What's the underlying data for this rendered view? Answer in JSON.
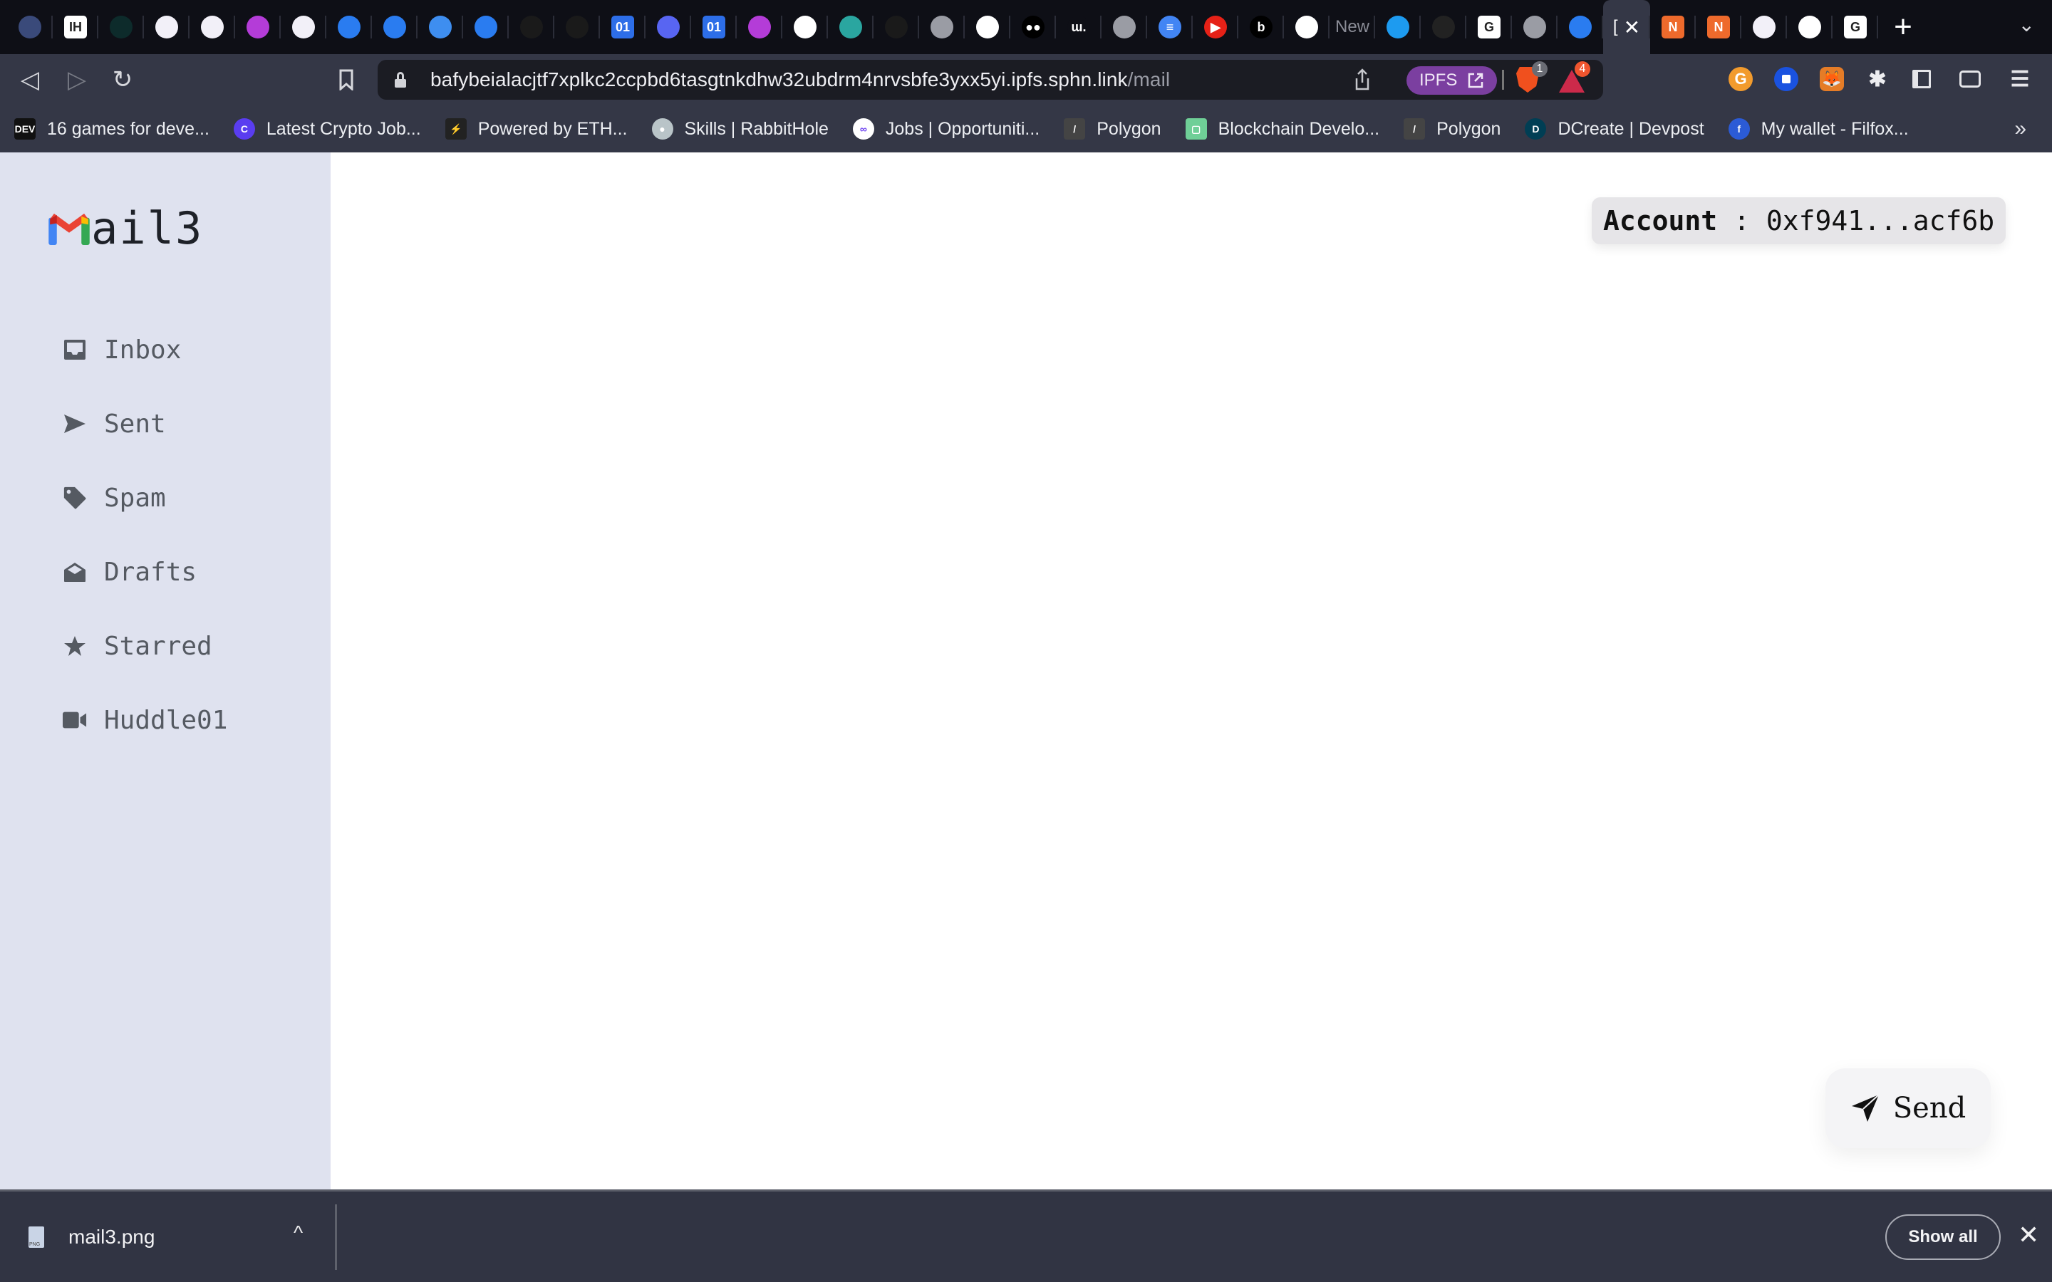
{
  "browser": {
    "tabs": [
      {
        "icon": "ring-icon",
        "color": "#3a4a7a"
      },
      {
        "icon": "indiehackers-icon",
        "color": "#ffffff",
        "glyph": "IH"
      },
      {
        "icon": "owl-icon",
        "color": "#0d2b2b"
      },
      {
        "icon": "ethereum-icon",
        "color": "#f2f0f8"
      },
      {
        "icon": "ethereum-icon",
        "color": "#f2f0f8"
      },
      {
        "icon": "bell-icon",
        "color": "#b43cd8"
      },
      {
        "icon": "ethereum-icon",
        "color": "#f2f0f8"
      },
      {
        "icon": "bolt-icon",
        "color": "#2a7cf0"
      },
      {
        "icon": "bolt-icon",
        "color": "#2a7cf0"
      },
      {
        "icon": "mail-icon",
        "color": "#3e8ef0"
      },
      {
        "icon": "bolt-icon",
        "color": "#2a7cf0"
      },
      {
        "icon": "tower-icon",
        "color": "#1a1a1a"
      },
      {
        "icon": "tower-icon",
        "color": "#1a1a1a"
      },
      {
        "icon": "huddle-icon",
        "color": "#2d6ee8",
        "glyph": "01"
      },
      {
        "icon": "discord-icon",
        "color": "#5865f2"
      },
      {
        "icon": "huddle-icon",
        "color": "#2d6ee8",
        "glyph": "01"
      },
      {
        "icon": "bell-icon",
        "color": "#b43cd8"
      },
      {
        "icon": "github-icon",
        "color": "#ffffff"
      },
      {
        "icon": "figure-icon",
        "color": "#2aa6a0"
      },
      {
        "icon": "tower-icon",
        "color": "#1a1a1a"
      },
      {
        "icon": "globe-icon",
        "color": "#9a9ca4"
      },
      {
        "icon": "github-icon",
        "color": "#ffffff"
      },
      {
        "icon": "medium-icon",
        "color": "#000000",
        "glyph": "●●"
      },
      {
        "icon": "w-icon",
        "color": "#0e0f16",
        "glyph": "ɯ."
      },
      {
        "icon": "globe-icon",
        "color": "#9a9ca4"
      },
      {
        "icon": "docs-icon",
        "color": "#4285f4",
        "glyph": "≡"
      },
      {
        "icon": "youtube-music-icon",
        "color": "#e62117",
        "glyph": "▶"
      },
      {
        "icon": "b-icon",
        "color": "#000000",
        "glyph": "b"
      },
      {
        "icon": "github-icon",
        "color": "#ffffff"
      },
      {
        "icon": "text-tab",
        "color": "",
        "text": "New"
      },
      {
        "icon": "twitter-icon",
        "color": "#1d9bf0"
      },
      {
        "icon": "graduation-cap-icon",
        "color": "#222222"
      },
      {
        "icon": "google-icon",
        "color": "#ffffff",
        "glyph": "G"
      },
      {
        "icon": "globe-icon",
        "color": "#9a9ca4"
      },
      {
        "icon": "bolt-icon",
        "color": "#2a7cf0"
      }
    ],
    "active_tab": {
      "glyph": "[",
      "close": "✕"
    },
    "tabs_after": [
      {
        "icon": "n-icon",
        "color": "#ee6a2c",
        "glyph": "N"
      },
      {
        "icon": "n-icon",
        "color": "#ee6a2c",
        "glyph": "N"
      },
      {
        "icon": "ethereum-icon",
        "color": "#f2f0f8"
      },
      {
        "icon": "github-icon",
        "color": "#ffffff"
      },
      {
        "icon": "google-icon",
        "color": "#ffffff",
        "glyph": "G"
      }
    ],
    "new_tab": "+",
    "tab_menu": "⌄",
    "nav": {
      "back": "◁",
      "forward": "▷",
      "reload": "↻",
      "bookmark": "🔖"
    },
    "url": {
      "host": "bafybeialacjtf7xplkc2ccpbd6tasgtnkdhw32ubdrm4nrvsbfe3yxx5yi.ipfs.sphn.link",
      "path": "/mail"
    },
    "ipfs_label": "IPFS",
    "shields_count": "1",
    "rewards_count": "4",
    "extensions": [
      "gitcoin-icon",
      "coinbase-icon",
      "metamask-icon",
      "puzzle-icon",
      "sidebar-icon",
      "wallet-icon",
      "menu-icon"
    ],
    "bookmarks": [
      {
        "icon": "dev-icon",
        "label": "16 games for deve...",
        "color": "#111111",
        "glyph": "DEV"
      },
      {
        "icon": "cryptojobs-icon",
        "label": "Latest Crypto Job...",
        "color": "#5a3df0",
        "glyph": "C"
      },
      {
        "icon": "lightning-icon",
        "label": "Powered by ETH...",
        "color": "#222222",
        "glyph": "⚡"
      },
      {
        "icon": "rabbithole-icon",
        "label": "Skills | RabbitHole",
        "color": "#b9c4c8",
        "glyph": "●"
      },
      {
        "icon": "polygon-jobs-icon",
        "label": "Jobs | Opportuniti...",
        "color": "#ffffff",
        "glyph": "∞"
      },
      {
        "icon": "polygon-icon",
        "label": "Polygon",
        "color": "#444444",
        "glyph": "/"
      },
      {
        "icon": "blockchain-icon",
        "label": "Blockchain Develo...",
        "color": "#6fcf97",
        "glyph": "▢"
      },
      {
        "icon": "polygon-icon",
        "label": "Polygon",
        "color": "#444444",
        "glyph": "/"
      },
      {
        "icon": "devpost-icon",
        "label": "DCreate | Devpost",
        "color": "#003e54",
        "glyph": "D"
      },
      {
        "icon": "filfox-icon",
        "label": "My wallet - Filfox...",
        "color": "#2b5bd6",
        "glyph": "f"
      }
    ],
    "bookmarks_more": "»"
  },
  "app": {
    "logo_text": "ail3",
    "logo_colors": {
      "red": "#ea4335",
      "blue": "#4285f4",
      "green": "#34a853",
      "yellow": "#fbbc04",
      "darkred": "#c5221f"
    },
    "nav": [
      {
        "label": "Inbox",
        "icon": "inbox-icon"
      },
      {
        "label": "Sent",
        "icon": "send-icon"
      },
      {
        "label": "Spam",
        "icon": "tag-icon"
      },
      {
        "label": "Drafts",
        "icon": "envelope-open-icon"
      },
      {
        "label": "Starred",
        "icon": "star-icon"
      },
      {
        "label": "Huddle01",
        "icon": "video-icon"
      }
    ],
    "account": {
      "label": "Account",
      "separator": ":",
      "address": "0xf941...acf6b"
    },
    "send_label": "Send"
  },
  "downloads": {
    "file_name": "mail3.png",
    "caret": "^",
    "show_all": "Show all",
    "close": "✕"
  }
}
